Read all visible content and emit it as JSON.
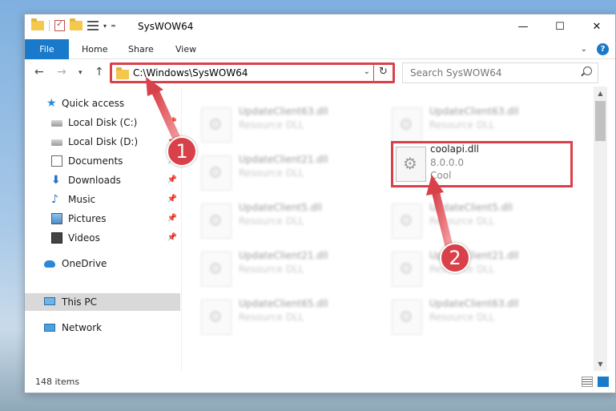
{
  "window": {
    "title": "SysWOW64",
    "controls": {
      "minimize": "—",
      "maximize": "☐",
      "close": "✕"
    }
  },
  "ribbon": {
    "tabs": [
      {
        "label": "File"
      },
      {
        "label": "Home"
      },
      {
        "label": "Share"
      },
      {
        "label": "View"
      }
    ],
    "help": "?"
  },
  "address": {
    "path": "C:\\Windows\\SysWOW64",
    "search_placeholder": "Search SysWOW64"
  },
  "nav": {
    "items": [
      {
        "label": "Quick access",
        "icon": "star-icon"
      },
      {
        "label": "Local Disk (C:)",
        "icon": "disk-icon"
      },
      {
        "label": "Local Disk (D:)",
        "icon": "disk-icon"
      },
      {
        "label": "Documents",
        "icon": "documents-icon"
      },
      {
        "label": "Downloads",
        "icon": "downloads-icon"
      },
      {
        "label": "Music",
        "icon": "music-icon"
      },
      {
        "label": "Pictures",
        "icon": "pictures-icon"
      },
      {
        "label": "Videos",
        "icon": "videos-icon"
      },
      {
        "label": "OneDrive",
        "icon": "onedrive-icon"
      },
      {
        "label": "This PC",
        "icon": "this-pc-icon"
      },
      {
        "label": "Network",
        "icon": "network-icon"
      }
    ]
  },
  "files": [
    {
      "name": "UpdateClient63.dll",
      "type": "Resource DLL"
    },
    {
      "name": "UpdateClient63.dll",
      "type": "Resource DLL"
    },
    {
      "name": "UpdateClient21.dll",
      "type": "Resource DLL"
    },
    {
      "name": "coolapi.dll",
      "version": "8.0.0.0",
      "company": "Cool"
    },
    {
      "name": "UpdateClient5.dll",
      "type": "Resource DLL"
    },
    {
      "name": "UpdateClient5.dll",
      "type": "Resource DLL"
    },
    {
      "name": "UpdateClient21.dll",
      "type": "Resource DLL"
    },
    {
      "name": "UpdateClient21.dll",
      "type": "Resource DLL"
    },
    {
      "name": "UpdateClient65.dll",
      "type": "Resource DLL"
    },
    {
      "name": "UpdateClient63.dll",
      "type": "Resource DLL"
    }
  ],
  "status": {
    "item_count": "148 items"
  },
  "callouts": [
    {
      "number": "1"
    },
    {
      "number": "2"
    }
  ],
  "colors": {
    "accent": "#1979ca",
    "highlight": "#d9414a"
  }
}
